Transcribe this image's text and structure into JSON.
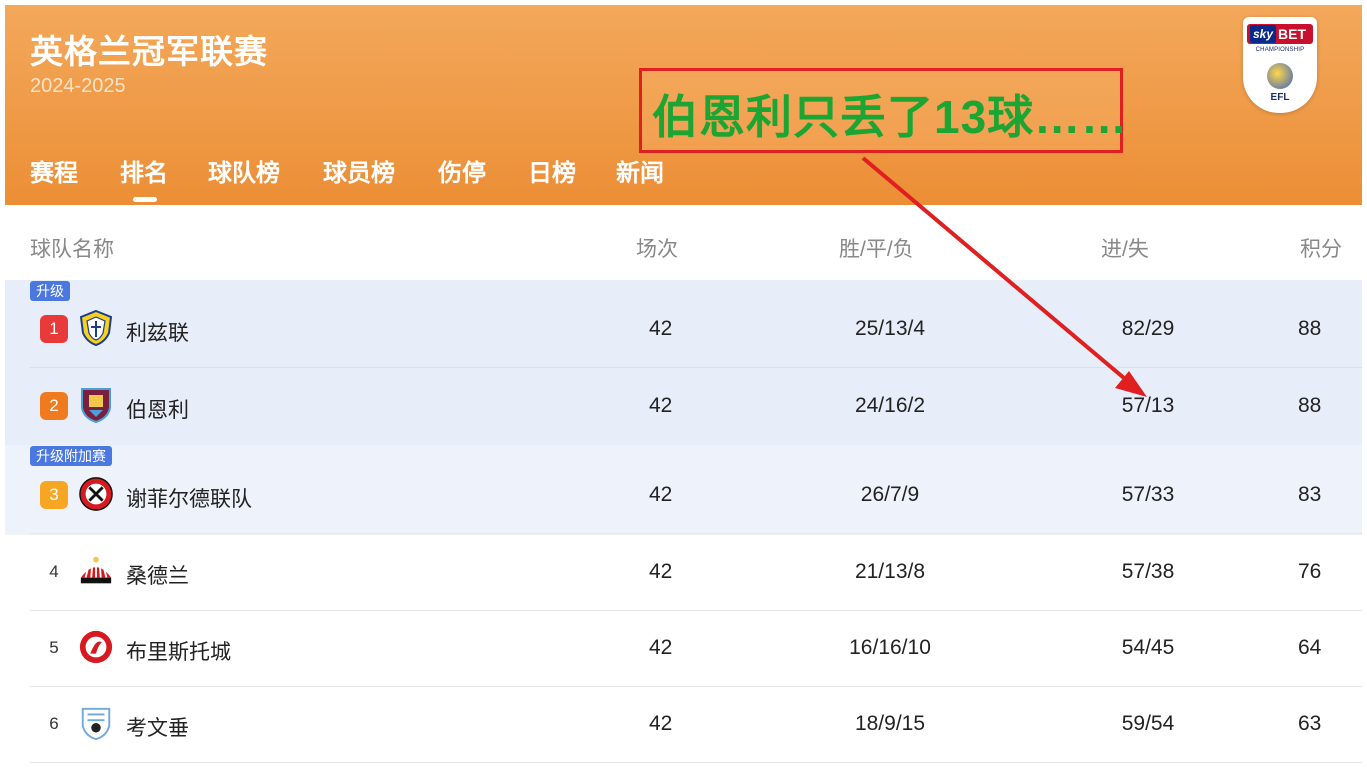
{
  "header": {
    "title": "英格兰冠军联赛",
    "season": "2024-2025",
    "logo": {
      "brand": "sky",
      "bet": "BET",
      "sub": "CHAMPIONSHIP",
      "efl": "EFL"
    }
  },
  "tabs": [
    {
      "label": "赛程"
    },
    {
      "label": "排名",
      "active": true
    },
    {
      "label": "球队榜"
    },
    {
      "label": "球员榜"
    },
    {
      "label": "伤停"
    },
    {
      "label": "日榜"
    },
    {
      "label": "新闻"
    }
  ],
  "annotation": {
    "text": "伯恩利只丢了13球……",
    "color": "#1da534",
    "box_color": "#e02020"
  },
  "table": {
    "headers": {
      "team": "球队名称",
      "played": "场次",
      "wdl": "胜/平/负",
      "goals": "进/失",
      "points": "积分"
    },
    "zones": {
      "promotion": "升级",
      "playoff": "升级附加赛"
    },
    "rows": [
      {
        "rank": "1",
        "team": "利兹联",
        "played": "42",
        "wdl": "25/13/4",
        "goals": "82/29",
        "points": "88",
        "rank_color": "#e83a3a",
        "crest": "leeds-crest-icon"
      },
      {
        "rank": "2",
        "team": "伯恩利",
        "played": "42",
        "wdl": "24/16/2",
        "goals": "57/13",
        "points": "88",
        "rank_color": "#f07a1e",
        "crest": "burnley-crest-icon"
      },
      {
        "rank": "3",
        "team": "谢菲尔德联队",
        "played": "42",
        "wdl": "26/7/9",
        "goals": "57/33",
        "points": "83",
        "rank_color": "#f6a623",
        "crest": "sheffield-united-crest-icon"
      },
      {
        "rank": "4",
        "team": "桑德兰",
        "played": "42",
        "wdl": "21/13/8",
        "goals": "57/38",
        "points": "76",
        "crest": "sunderland-crest-icon"
      },
      {
        "rank": "5",
        "team": "布里斯托城",
        "played": "42",
        "wdl": "16/16/10",
        "goals": "54/45",
        "points": "64",
        "crest": "bristol-city-crest-icon"
      },
      {
        "rank": "6",
        "team": "考文垂",
        "played": "42",
        "wdl": "18/9/15",
        "goals": "59/54",
        "points": "63",
        "crest": "coventry-crest-icon"
      }
    ]
  }
}
